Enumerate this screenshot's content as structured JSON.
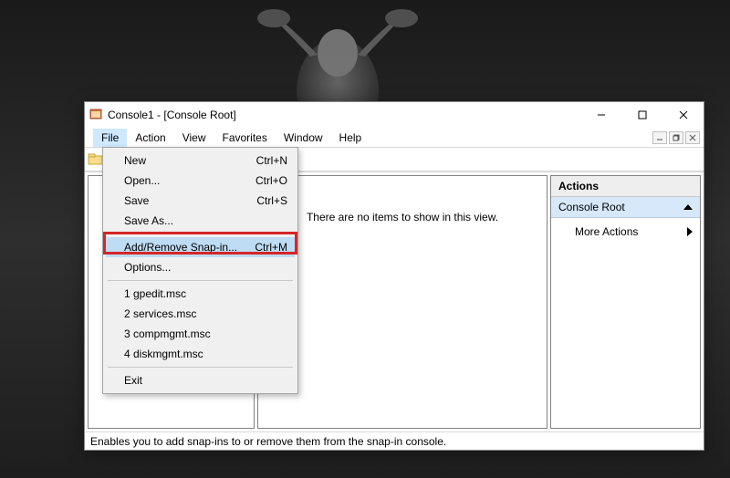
{
  "window": {
    "title": "Console1 - [Console Root]"
  },
  "menubar": {
    "file": "File",
    "action": "Action",
    "view": "View",
    "favorites": "Favorites",
    "window": "Window",
    "help": "Help"
  },
  "file_menu": {
    "new": {
      "label": "New",
      "shortcut": "Ctrl+N"
    },
    "open": {
      "label": "Open...",
      "shortcut": "Ctrl+O"
    },
    "save": {
      "label": "Save",
      "shortcut": "Ctrl+S"
    },
    "save_as": {
      "label": "Save As..."
    },
    "add_remove": {
      "label": "Add/Remove Snap-in...",
      "shortcut": "Ctrl+M"
    },
    "options": {
      "label": "Options..."
    },
    "recent1": {
      "label": "1 gpedit.msc"
    },
    "recent2": {
      "label": "2 services.msc"
    },
    "recent3": {
      "label": "3 compmgmt.msc"
    },
    "recent4": {
      "label": "4 diskmgmt.msc"
    },
    "exit": {
      "label": "Exit"
    }
  },
  "center": {
    "empty_text": "There are no items to show in this view."
  },
  "actions": {
    "header": "Actions",
    "subheader": "Console Root",
    "more": "More Actions"
  },
  "statusbar": {
    "text": "Enables you to add snap-ins to or remove them from the snap-in console."
  }
}
